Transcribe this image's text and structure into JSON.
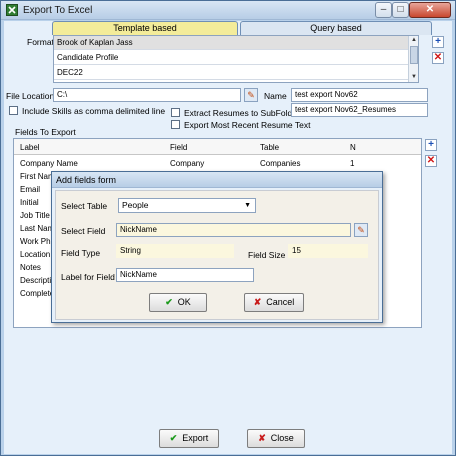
{
  "window": {
    "title": "Export To Excel",
    "controls": {
      "minimize": "–",
      "maximize": "□",
      "close": "✕"
    }
  },
  "tabs": [
    {
      "label": "Template based",
      "active": true
    },
    {
      "label": "Query based",
      "active": false
    }
  ],
  "format": {
    "label": "Format",
    "items": [
      "Brook of Kaplan Jass",
      "Candidate Profile",
      "DEC22"
    ],
    "selected_index": 0
  },
  "file_location": {
    "label": "File Location",
    "value": "C:\\"
  },
  "name": {
    "label": "Name",
    "value": "test export Nov62"
  },
  "subfolder_value": "test export Nov62_Resumes",
  "checkboxes": {
    "include_skills": "Include Skills as comma delimited line",
    "extract_resumes": "Extract Resumes to SubFolde",
    "most_recent": "Export Most Recent Resume Text"
  },
  "fields_to_export": {
    "label": "Fields To Export",
    "columns": [
      "Label",
      "Field",
      "Table",
      "N"
    ],
    "first_row": [
      "Company Name",
      "Company",
      "Companies",
      "1"
    ],
    "other_row_labels": [
      "First Nam",
      "Email",
      "Initial",
      "Job Title",
      "Last Nam",
      "Work Ph",
      "Location",
      "Notes",
      "Descripti",
      "Complete"
    ]
  },
  "dialog": {
    "title": "Add fields form",
    "select_table_label": "Select Table",
    "select_table_value": "People",
    "select_field_label": "Select Field",
    "select_field_value": "NickName",
    "field_type_label": "Field Type",
    "field_type_value": "String",
    "field_size_label": "Field Size",
    "field_size_value": "15",
    "label_for_field_label": "Label for Field",
    "label_for_field_value": "NickName",
    "ok": "OK",
    "cancel": "Cancel"
  },
  "footer": {
    "export": "Export",
    "close": "Close"
  },
  "colors": {
    "active_tab": "#f3ec9a",
    "window_bg": "#e6f0fa",
    "plus_blue": "#1b4fb5",
    "delete_red": "#d01818"
  }
}
